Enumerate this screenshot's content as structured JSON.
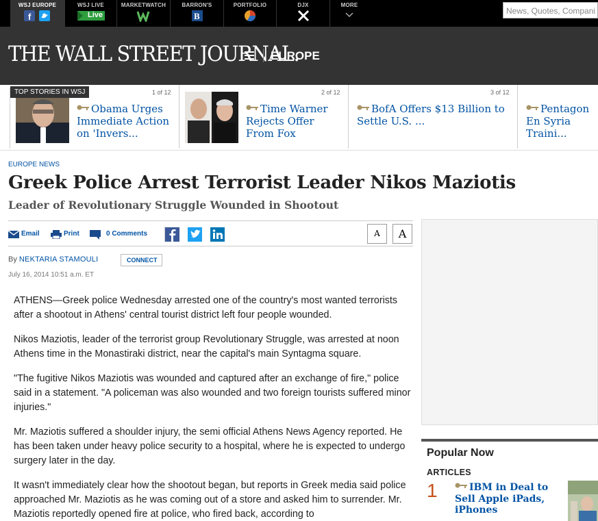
{
  "topnav": {
    "items": [
      {
        "label": "WSJ EUROPE"
      },
      {
        "label": "WSJ LIVE",
        "badge": "Live"
      },
      {
        "label": "MARKETWATCH"
      },
      {
        "label": "BARRON'S"
      },
      {
        "label": "PORTFOLIO"
      },
      {
        "label": "DJX"
      },
      {
        "label": "MORE"
      }
    ],
    "search_placeholder": "News, Quotes, Compani"
  },
  "masthead": {
    "logo": "THE WALL STREET JOURNAL.",
    "edition": "EUROPE"
  },
  "top_stories": {
    "label": "TOP STORIES IN WSJ",
    "items": [
      {
        "count": "1 of 12",
        "headline": "Obama Urges Immediate Action on 'Invers..."
      },
      {
        "count": "2 of 12",
        "headline": "Time Warner Rejects Offer From Fox"
      },
      {
        "count": "3 of 12",
        "headline": "BofA Offers $13 Billion to Settle U.S. ..."
      },
      {
        "count": "",
        "headline": "Pentagon En Syria Traini..."
      }
    ]
  },
  "article": {
    "section": "EUROPE NEWS",
    "title": "Greek Police Arrest Terrorist Leader Nikos Maziotis",
    "subtitle": "Leader of Revolutionary Struggle Wounded in Shootout",
    "tools": {
      "email": "Email",
      "print": "Print",
      "comments": "0 Comments"
    },
    "font_small": "A",
    "font_large": "A",
    "by": "By",
    "author": "NEKTARIA STAMOULI",
    "connect": "CONNECT",
    "timestamp": "July 16, 2014 10:51 a.m. ET",
    "paragraphs": [
      "ATHENS—Greek police Wednesday arrested one of the country's most wanted terrorists after a shootout in Athens' central tourist district left four people wounded.",
      "Nikos Maziotis, leader of the terrorist group Revolutionary Struggle, was arrested at noon Athens time in the Monastiraki district, near the capital's main Syntagma square.",
      "\"The fugitive Nikos Maziotis was wounded and captured after an exchange of fire,\" police said in a statement. \"A policeman was also wounded and two foreign tourists suffered minor injuries.\"",
      "Mr. Maziotis suffered a shoulder injury, the semi official Athens News Agency reported. He has been taken under heavy police security to a hospital, where he is expected to undergo surgery later in the day.",
      "It wasn't immediately clear how the shootout began, but reports in Greek media said police approached Mr. Maziotis as he was coming out of a store and asked him to surrender. Mr. Maziotis reportedly opened fire at police, who fired back, according to"
    ]
  },
  "popular": {
    "title": "Popular Now",
    "subtitle": "ARTICLES",
    "items": [
      {
        "rank": "1",
        "headline": "IBM in Deal to Sell Apple iPads, iPhones"
      }
    ]
  },
  "colors": {
    "link": "#0253a4",
    "masthead_bg": "#333333",
    "topnav_bg": "#000000",
    "rank": "#c4521a",
    "live_badge": "#2e9e3f"
  }
}
